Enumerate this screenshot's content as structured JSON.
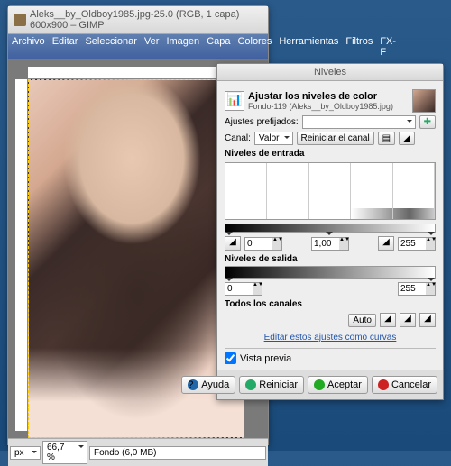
{
  "main": {
    "title": "Aleks__by_Oldboy1985.jpg-25.0 (RGB, 1 capa) 600x900 – GIMP",
    "menu": [
      "Archivo",
      "Editar",
      "Seleccionar",
      "Ver",
      "Imagen",
      "Capa",
      "Colores",
      "Herramientas",
      "Filtros",
      "FX-F"
    ],
    "status": {
      "units": "px",
      "zoom": "66,7 %",
      "layer": "Fondo (6,0 MB)"
    }
  },
  "levels": {
    "title": "Niveles",
    "heading": "Ajustar los niveles de color",
    "sub": "Fondo-119 (Aleks__by_Oldboy1985.jpg)",
    "presets_label": "Ajustes prefijados:",
    "channel_label": "Canal:",
    "channel_value": "Valor",
    "reset_channel": "Reiniciar el canal",
    "input_levels": "Niveles de entrada",
    "output_levels": "Niveles de salida",
    "all_channels": "Todos los canales",
    "auto": "Auto",
    "edit_curves": "Editar estos ajustes como curvas",
    "preview": "Vista previa",
    "in_low": "0",
    "in_gamma": "1,00",
    "in_high": "255",
    "out_low": "0",
    "out_high": "255",
    "buttons": {
      "help": "Ayuda",
      "reset": "Reiniciar",
      "ok": "Aceptar",
      "cancel": "Cancelar"
    }
  }
}
